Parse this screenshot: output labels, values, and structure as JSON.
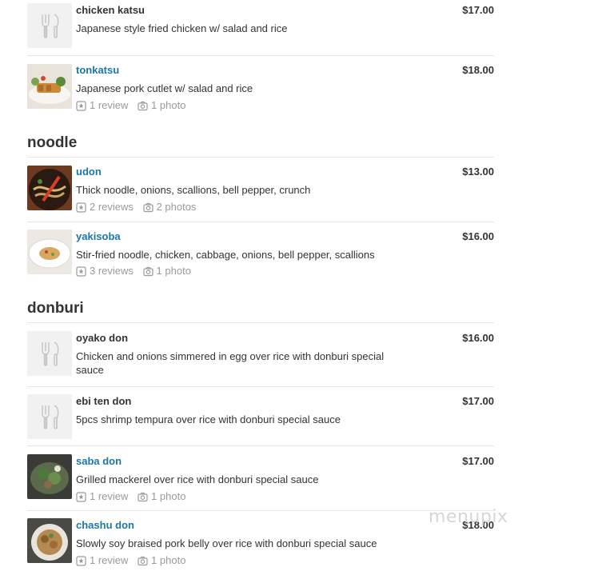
{
  "sections": {
    "katsu": {
      "items": [
        {
          "name": "chicken katsu",
          "price": "$17.00",
          "description": "Japanese style fried chicken w/ salad and rice"
        },
        {
          "name": "tonkatsu",
          "price": "$18.00",
          "description": "Japanese pork cutlet w/ salad and rice",
          "reviews": "1 review",
          "photos": "1 photo"
        }
      ]
    },
    "noodle": {
      "title": "noodle",
      "items": [
        {
          "name": "udon",
          "price": "$13.00",
          "description": "Thick noodle, onions, scallions, bell pepper, crunch",
          "reviews": "2 reviews",
          "photos": "2 photos"
        },
        {
          "name": "yakisoba",
          "price": "$16.00",
          "description": "Stir-fried noodle, chicken, cabbage, onions, bell pepper, scallions",
          "reviews": "3 reviews",
          "photos": "1 photo"
        }
      ]
    },
    "donburi": {
      "title": "donburi",
      "items": [
        {
          "name": "oyako don",
          "price": "$16.00",
          "description": "Chicken and onions simmered in egg over rice with donburi special sauce"
        },
        {
          "name": "ebi ten don",
          "price": "$17.00",
          "description": "5pcs shrimp tempura over rice with donburi special sauce"
        },
        {
          "name": "saba don",
          "price": "$17.00",
          "description": "Grilled mackerel over rice with donburi special sauce",
          "reviews": "1 review",
          "photos": "1 photo"
        },
        {
          "name": "chashu don",
          "price": "$18.00",
          "description": "Slowly soy braised pork belly over rice with donburi special sauce",
          "reviews": "1 review",
          "photos": "1 photo"
        }
      ]
    }
  },
  "watermark": "menupix",
  "colors": {
    "link": "#1b77a4",
    "text": "#333333",
    "muted": "#9a9a9a",
    "divider": "#e6e6e6"
  },
  "icons": {
    "placeholder": "fork-knife-icon",
    "review": "star-icon",
    "photo": "camera-icon"
  }
}
